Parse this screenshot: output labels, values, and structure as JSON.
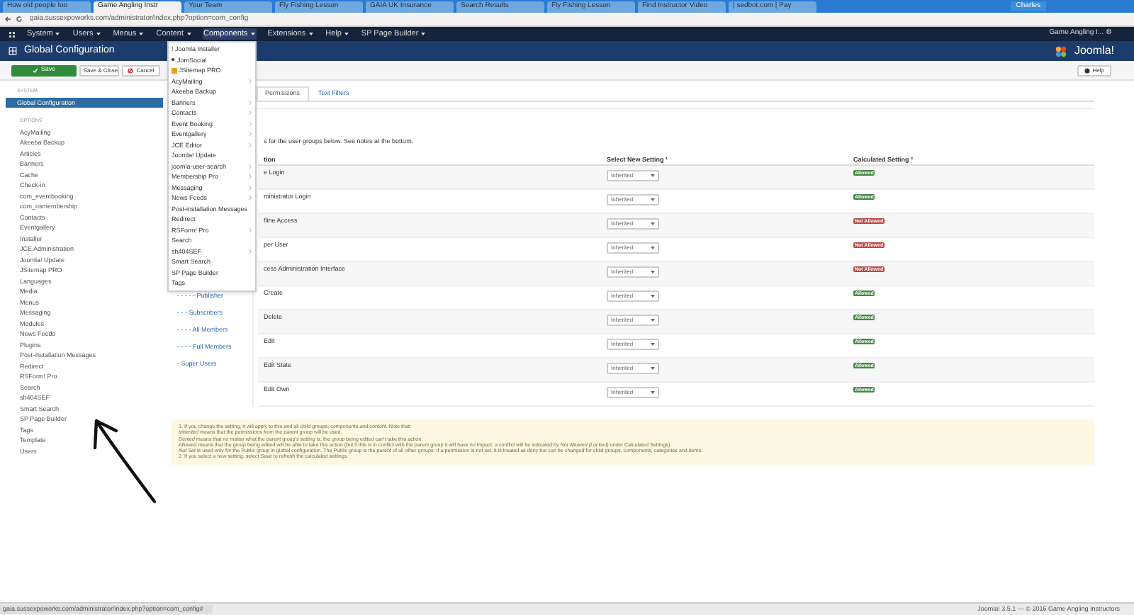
{
  "browser": {
    "tabs": [
      {
        "label": "How old people loo",
        "selected": false
      },
      {
        "label": "Game Angling Instr",
        "selected": true
      },
      {
        "label": "Your Team",
        "selected": false
      },
      {
        "label": "Fly Fishing Lesson",
        "selected": false
      },
      {
        "label": "GAIA UK Insurance",
        "selected": false
      },
      {
        "label": "Search Results",
        "selected": false
      },
      {
        "label": "Fly Fishing Lesson",
        "selected": false
      },
      {
        "label": "Find Instructor Video",
        "selected": false
      },
      {
        "label": "| sedbot.com | Pay",
        "selected": false
      }
    ],
    "user": "Charles",
    "url": "gaia.sussexpoworks.com/administrator/index.php?option=com_config"
  },
  "nav": {
    "items": [
      {
        "label": "System",
        "selected": false
      },
      {
        "label": "Users",
        "selected": false
      },
      {
        "label": "Menus",
        "selected": false
      },
      {
        "label": "Content",
        "selected": false
      },
      {
        "label": "Components",
        "selected": true
      },
      {
        "label": "Extensions",
        "selected": false
      },
      {
        "label": "Help",
        "selected": false
      },
      {
        "label": "SP Page Builder",
        "selected": false
      }
    ],
    "site": "Game Angling I... ⚙"
  },
  "title": "Global Configuration",
  "logo": "Joomla!",
  "toolbar": {
    "save": "Save",
    "save_close": "Save & Close",
    "cancel": "Cancel",
    "help": "Help"
  },
  "sidebar": {
    "system_heading": "SYSTEM",
    "system_items": [
      {
        "label": "Global Configuration",
        "selected": true
      }
    ],
    "options_heading": "OPTIONS",
    "items": [
      "AcyMailing",
      "Akeeba Backup",
      "Articles",
      "Banners",
      "Cache",
      "Check-in",
      "com_eventbooking",
      "com_osmembership",
      "Contacts",
      "Eventgallery",
      "Installer",
      "JCE Administration",
      "Joomla! Update",
      "JSitemap PRO",
      "Languages",
      "Media",
      "Menus",
      "Messaging",
      "Modules",
      "News Feeds",
      "Plugins",
      "Post-installation Messages",
      "Redirect",
      "RSForm! Pro",
      "Search",
      "sh404SEF",
      "Smart Search",
      "SP Page Builder",
      "Tags",
      "Template",
      "Users"
    ]
  },
  "tabs": [
    {
      "label": "Permissions",
      "selected": true
    },
    {
      "label": "Text Filters",
      "selected": false
    }
  ],
  "intro": "s for the user groups below. See notes at the bottom.",
  "groups": [
    "- - - - - Publisher",
    "- - - Subscribers",
    "- - - - All Members",
    "- - - - Full Members",
    "- Super Users"
  ],
  "table": {
    "columns": [
      "tion",
      "Select New Setting ¹",
      "Calculated Setting ²"
    ],
    "rows": [
      {
        "action": "e Login",
        "setting": "Inherited",
        "calculated": "Allowed",
        "allowed": true
      },
      {
        "action": "ministrator Login",
        "setting": "Inherited",
        "calculated": "Allowed",
        "allowed": true
      },
      {
        "action": "fline Access",
        "setting": "Inherited",
        "calculated": "Not Allowed",
        "allowed": false
      },
      {
        "action": "per User",
        "setting": "Inherited",
        "calculated": "Not Allowed",
        "allowed": false
      },
      {
        "action": "cess Administration Interface",
        "setting": "Inherited",
        "calculated": "Not Allowed",
        "allowed": false
      },
      {
        "action": "Create",
        "setting": "Inherited",
        "calculated": "Allowed",
        "allowed": true
      },
      {
        "action": "Delete",
        "setting": "Inherited",
        "calculated": "Allowed",
        "allowed": true
      },
      {
        "action": "Edit",
        "setting": "Inherited",
        "calculated": "Allowed",
        "allowed": true
      },
      {
        "action": "Edit State",
        "setting": "Inherited",
        "calculated": "Allowed",
        "allowed": true
      },
      {
        "action": "Edit Own",
        "setting": "Inherited",
        "calculated": "Allowed",
        "allowed": true
      }
    ]
  },
  "notes": [
    "1. If you change the setting, it will apply to this and all child groups, components and content. Note that:",
    "*Inherited* means that the permissions from the parent group will be used.",
    "*Denied* means that no matter what the parent group's setting is, the group being edited can't take this action.",
    "*Allowed* means that the group being edited will be able to take this action (but if this is in conflict with the parent group it will have no impact; a conflict will be indicated by *Not Allowed (Locked)* under Calculated Settings).",
    "*Not Set* is used only for the Public group in global configuration. The Public group is the parent of all other groups. If a permission is not set, it is treated as deny but can be changed for child groups, components, categories and items.",
    "2. If you select a new setting, select *Save* to refresh the calculated settings."
  ],
  "menu": [
    {
      "label": "! Joomla Installer",
      "kind": "plain",
      "submenu": false
    },
    {
      "label": "JomSocial",
      "kind": "bullet",
      "submenu": false
    },
    {
      "label": "JSitemap PRO",
      "kind": "icon",
      "submenu": false
    },
    {
      "label": "AcyMailing",
      "kind": "plain",
      "submenu": true
    },
    {
      "label": "Akeeba Backup",
      "kind": "plain",
      "submenu": false
    },
    {
      "label": "Banners",
      "kind": "plain",
      "submenu": true
    },
    {
      "label": "Contacts",
      "kind": "plain",
      "submenu": true
    },
    {
      "label": "Event Booking",
      "kind": "plain",
      "submenu": true
    },
    {
      "label": "Eventgallery",
      "kind": "plain",
      "submenu": true
    },
    {
      "label": "JCE Editor",
      "kind": "plain",
      "submenu": true
    },
    {
      "label": "Joomla! Update",
      "kind": "plain",
      "submenu": false
    },
    {
      "label": "joomla-user-search",
      "kind": "plain",
      "submenu": true
    },
    {
      "label": "Membership Pro",
      "kind": "plain",
      "submenu": true
    },
    {
      "label": "Messaging",
      "kind": "plain",
      "submenu": true
    },
    {
      "label": "News Feeds",
      "kind": "plain",
      "submenu": true
    },
    {
      "label": "Post-installation Messages",
      "kind": "plain",
      "submenu": false
    },
    {
      "label": "Redirect",
      "kind": "plain",
      "submenu": false
    },
    {
      "label": "RSForm! Pro",
      "kind": "plain",
      "submenu": true
    },
    {
      "label": "Search",
      "kind": "plain",
      "submenu": false
    },
    {
      "label": "sh404SEF",
      "kind": "plain",
      "submenu": true
    },
    {
      "label": "Smart Search",
      "kind": "plain",
      "submenu": false
    },
    {
      "label": "SP Page Builder",
      "kind": "plain",
      "submenu": false
    },
    {
      "label": "Tags",
      "kind": "plain",
      "submenu": false
    }
  ],
  "status": {
    "url": "gaia.sussexpoworks.com/administrator/index.php?option=com_config#",
    "footer": "Joomla! 3.5.1 — © 2016 Game Angling Instructors"
  }
}
